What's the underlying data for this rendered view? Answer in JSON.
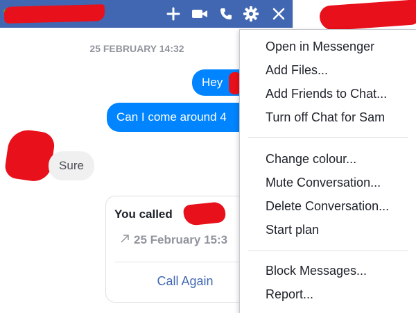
{
  "header": {
    "buttons": [
      {
        "name": "add-people-icon",
        "symbol": "+"
      },
      {
        "name": "video-call-icon"
      },
      {
        "name": "voice-call-icon"
      },
      {
        "name": "gear-icon"
      },
      {
        "name": "close-icon",
        "symbol": "✕"
      }
    ],
    "colors": {
      "bar": "#4267b2",
      "icon": "#ffffff"
    }
  },
  "chat": {
    "date_separator": "25 FEBRUARY 14:32",
    "messages": [
      {
        "from": "me",
        "text": "Hey"
      },
      {
        "from": "me",
        "text": "Can I come around 4"
      },
      {
        "from": "contact",
        "text": "Sure"
      }
    ],
    "call_card": {
      "title": "You called",
      "time": "25 February 15:3",
      "time_icon": "outgoing-call-arrow-icon",
      "action": "Call Again"
    },
    "colors": {
      "outgoing": "#0084ff",
      "incoming": "#f1f0f0",
      "link": "#4267b2"
    }
  },
  "menu": {
    "groups": [
      [
        "Open in Messenger",
        "Add Files...",
        "Add Friends to Chat...",
        "Turn off Chat for Sam"
      ],
      [
        "Change colour...",
        "Mute Conversation...",
        "Delete Conversation...",
        "Start plan"
      ],
      [
        "Block Messages...",
        "Report..."
      ]
    ]
  }
}
